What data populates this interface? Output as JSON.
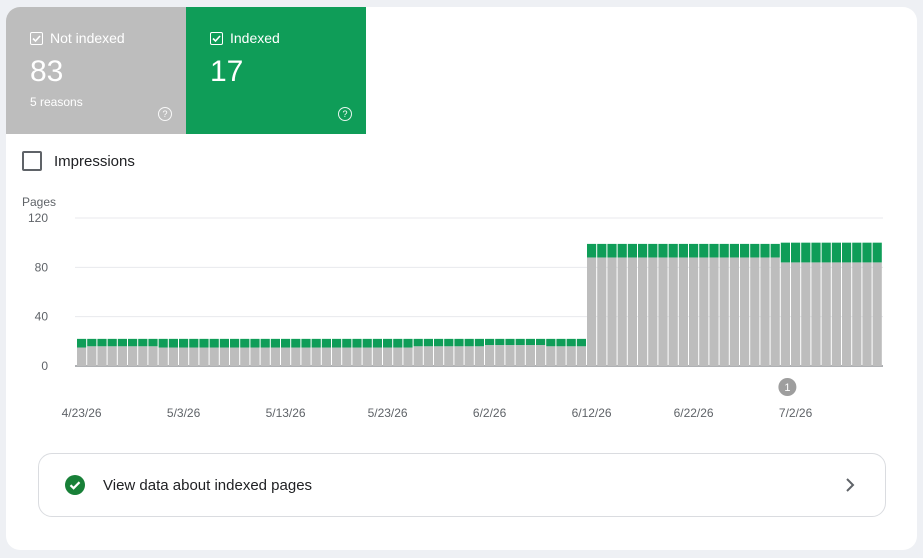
{
  "tiles": {
    "not_indexed": {
      "label": "Not indexed",
      "value": "83",
      "sub": "5 reasons",
      "color": "#bdbdbd"
    },
    "indexed": {
      "label": "Indexed",
      "value": "17",
      "color": "#0f9d58"
    }
  },
  "impressions_label": "Impressions",
  "link_card": {
    "label": "View data about indexed pages"
  },
  "chart_data": {
    "type": "bar",
    "stacked": true,
    "ylabel": "Pages",
    "ylim": [
      0,
      120
    ],
    "yticks": [
      "0",
      "40",
      "80",
      "120"
    ],
    "xticks": [
      {
        "label": "4/23/26",
        "index": 0
      },
      {
        "label": "5/3/26",
        "index": 10
      },
      {
        "label": "5/13/26",
        "index": 20
      },
      {
        "label": "5/23/26",
        "index": 30
      },
      {
        "label": "6/2/26",
        "index": 40
      },
      {
        "label": "6/12/26",
        "index": 50
      },
      {
        "label": "6/22/26",
        "index": 60
      },
      {
        "label": "7/2/26",
        "index": 70
      }
    ],
    "annotation": {
      "label": "1",
      "index": 69
    },
    "series": [
      {
        "name": "Not indexed",
        "color": "#bdbdbd",
        "values": [
          15,
          16,
          16,
          16,
          16,
          16,
          16,
          16,
          15,
          15,
          15,
          15,
          15,
          15,
          15,
          15,
          15,
          15,
          15,
          15,
          15,
          15,
          15,
          15,
          15,
          15,
          15,
          15,
          15,
          15,
          15,
          15,
          15,
          16,
          16,
          16,
          16,
          16,
          16,
          16,
          17,
          17,
          17,
          17,
          17,
          17,
          16,
          16,
          16,
          16,
          88,
          88,
          88,
          88,
          88,
          88,
          88,
          88,
          88,
          88,
          88,
          88,
          88,
          88,
          88,
          88,
          88,
          88,
          88,
          84,
          84,
          84,
          84,
          84,
          84,
          84,
          84,
          84,
          84
        ]
      },
      {
        "name": "Indexed",
        "color": "#0f9d58",
        "values": [
          7,
          6,
          6,
          6,
          6,
          6,
          6,
          6,
          7,
          7,
          7,
          7,
          7,
          7,
          7,
          7,
          7,
          7,
          7,
          7,
          7,
          7,
          7,
          7,
          7,
          7,
          7,
          7,
          7,
          7,
          7,
          7,
          7,
          6,
          6,
          6,
          6,
          6,
          6,
          6,
          5,
          5,
          5,
          5,
          5,
          5,
          6,
          6,
          6,
          6,
          11,
          11,
          11,
          11,
          11,
          11,
          11,
          11,
          11,
          11,
          11,
          11,
          11,
          11,
          11,
          11,
          11,
          11,
          11,
          16,
          16,
          16,
          16,
          16,
          16,
          16,
          16,
          16,
          16
        ]
      }
    ]
  }
}
